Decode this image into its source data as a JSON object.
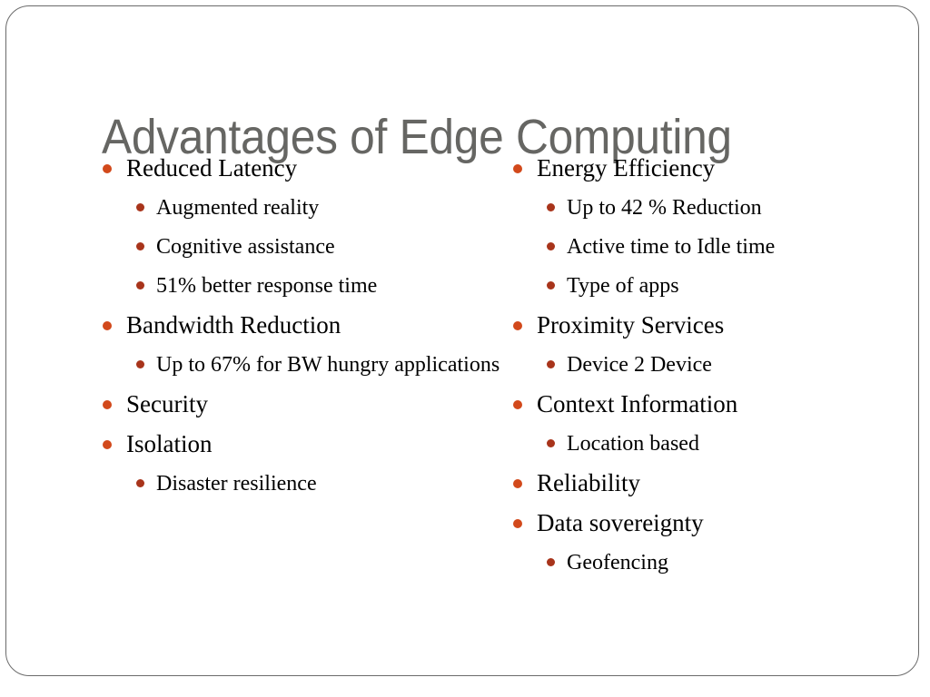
{
  "slide": {
    "title": "Advantages of Edge Computing",
    "title_color": "#666663",
    "background_color": "#FFFFFF",
    "border_color": "#6B6B6B",
    "bullet_color_level1": "#D2491B",
    "bullet_color_level2": "#A8341B",
    "text_color": "#000000"
  },
  "columns": {
    "left": [
      {
        "label": "Reduced Latency",
        "children": [
          {
            "label": "Augmented reality"
          },
          {
            "label": "Cognitive assistance"
          },
          {
            "label": "51% better response time"
          }
        ]
      },
      {
        "label": "Bandwidth Reduction",
        "children": [
          {
            "label": "Up to 67% for BW hungry applications"
          }
        ]
      },
      {
        "label": "Security",
        "children": []
      },
      {
        "label": "Isolation",
        "children": [
          {
            "label": "Disaster resilience"
          }
        ]
      }
    ],
    "right": [
      {
        "label": "Energy Efficiency",
        "children": [
          {
            "label": "Up to 42 % Reduction"
          },
          {
            "label": "Active time to Idle time"
          },
          {
            "label": "Type of apps"
          }
        ]
      },
      {
        "label": "Proximity Services",
        "children": [
          {
            "label": "Device 2 Device"
          }
        ]
      },
      {
        "label": "Context Information",
        "children": [
          {
            "label": "Location based"
          }
        ]
      },
      {
        "label": "Reliability",
        "children": []
      },
      {
        "label": "Data sovereignty",
        "children": [
          {
            "label": "Geofencing"
          }
        ]
      }
    ]
  }
}
